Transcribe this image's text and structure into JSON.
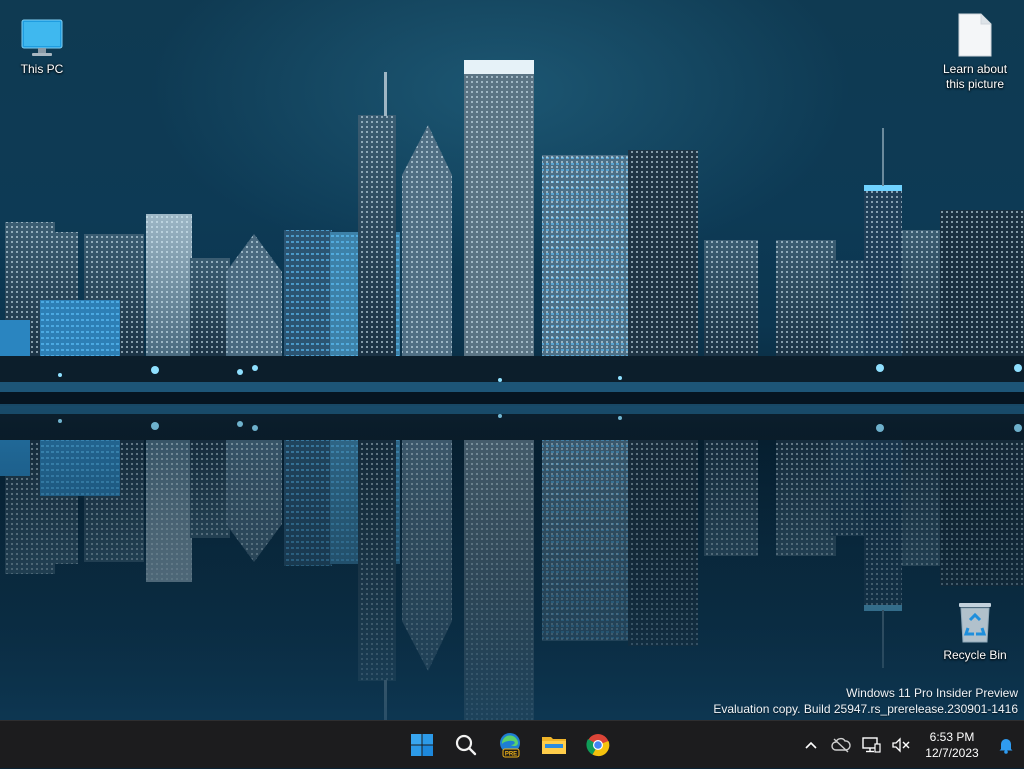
{
  "desktop": {
    "icons": {
      "this_pc": {
        "label": "This PC"
      },
      "learn_picture": {
        "label_line1": "Learn about",
        "label_line2": "this picture"
      },
      "recycle_bin": {
        "label": "Recycle Bin"
      }
    }
  },
  "watermark": {
    "line1": "Windows 11 Pro Insider Preview",
    "line2": "Evaluation copy. Build 25947.rs_prerelease.230901-1416"
  },
  "taskbar": {
    "apps": [
      {
        "name": "start",
        "icon": "windows-logo-icon"
      },
      {
        "name": "search",
        "icon": "search-icon"
      },
      {
        "name": "edge",
        "icon": "edge-pre-icon",
        "badge": "PRE"
      },
      {
        "name": "file-explorer",
        "icon": "folder-icon"
      },
      {
        "name": "chrome",
        "icon": "chrome-icon"
      }
    ],
    "tray": {
      "icons": [
        "chevron-up-icon",
        "onedrive-icon",
        "network-icon",
        "volume-muted-icon"
      ],
      "time": "6:53 PM",
      "date": "12/7/2023",
      "notification_icon": "bell-icon"
    }
  },
  "colors": {
    "taskbar_bg": "#1c1c1e",
    "accent_blue": "#0a84d8",
    "wallpaper_sky": "#0f3a52"
  }
}
